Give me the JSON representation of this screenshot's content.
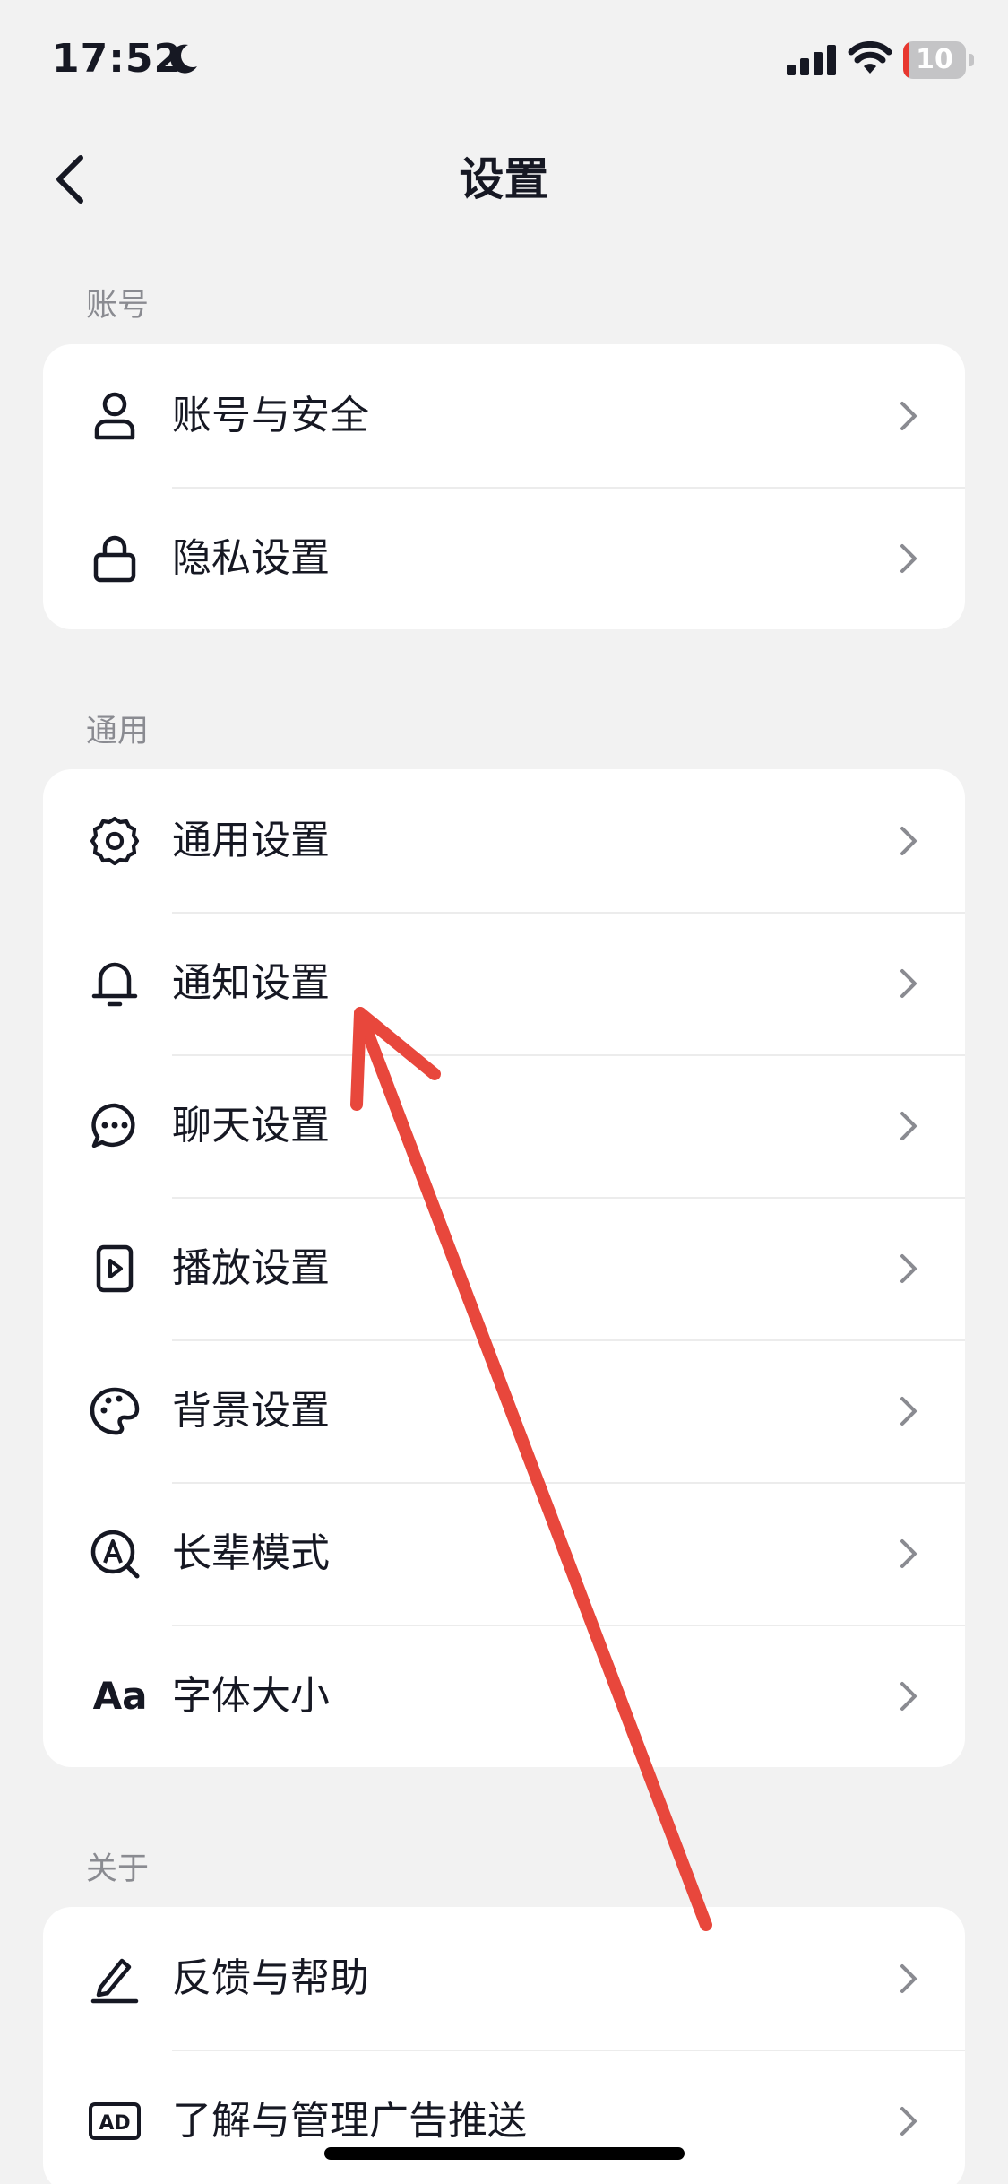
{
  "status_bar": {
    "time": "17:52",
    "battery_level": "10",
    "battery_fraction": 0.1
  },
  "nav": {
    "title": "设置"
  },
  "sections": [
    {
      "header": "账号",
      "items": [
        {
          "label": "账号与安全",
          "icon": "user-icon"
        },
        {
          "label": "隐私设置",
          "icon": "lock-icon"
        }
      ]
    },
    {
      "header": "通用",
      "items": [
        {
          "label": "通用设置",
          "icon": "gear-icon"
        },
        {
          "label": "通知设置",
          "icon": "bell-icon"
        },
        {
          "label": "聊天设置",
          "icon": "chat-bubble-icon"
        },
        {
          "label": "播放设置",
          "icon": "play-icon"
        },
        {
          "label": "背景设置",
          "icon": "palette-icon"
        },
        {
          "label": "长辈模式",
          "icon": "elder-mode-icon"
        },
        {
          "label": "字体大小",
          "icon": "font-size-icon",
          "icon_text": "Aa"
        }
      ]
    },
    {
      "header": "关于",
      "items": [
        {
          "label": "反馈与帮助",
          "icon": "pencil-icon"
        },
        {
          "label": "了解与管理广告推送",
          "icon": "ad-icon",
          "icon_text": "AD"
        }
      ]
    }
  ],
  "annotation": {
    "color": "#e8473c",
    "points_to": "通知设置"
  },
  "colors": {
    "background": "#f2f2f2",
    "card": "#ffffff",
    "text": "#161823",
    "secondary_text": "#8a8b91"
  }
}
